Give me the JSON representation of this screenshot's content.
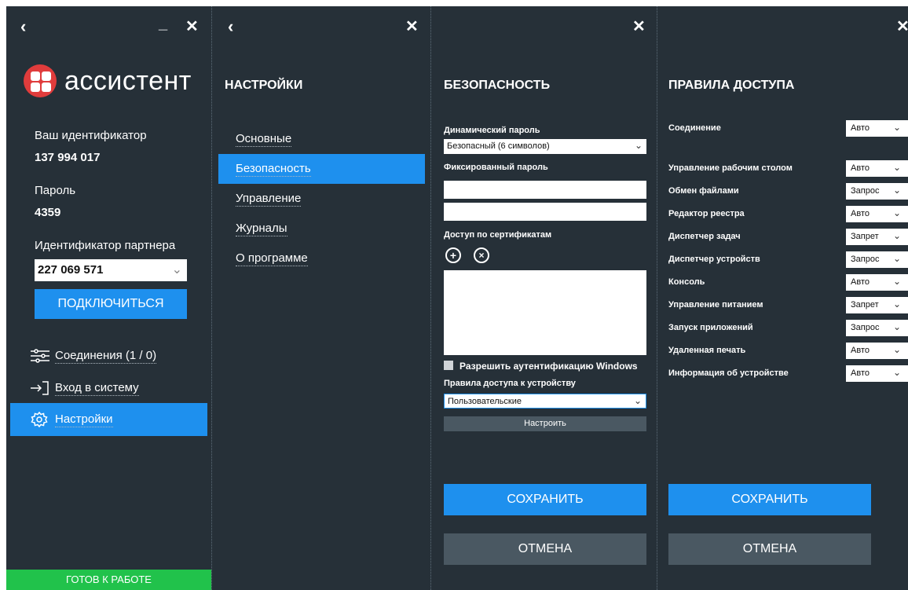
{
  "assistant": {
    "brand": "ассистент",
    "your_id_label": "Ваш идентификатор",
    "your_id_value": "137 994 017",
    "password_label": "Пароль",
    "password_value": "4359",
    "partner_label": "Идентификатор партнера",
    "partner_value": "227 069 571",
    "connect_label": "ПОДКЛЮЧИТЬСЯ",
    "menu": [
      {
        "label": "Соединения (1 / 0)",
        "icon": "sliders-icon"
      },
      {
        "label": "Вход в систему",
        "icon": "login-icon"
      },
      {
        "label": "Настройки",
        "icon": "gear-icon",
        "selected": true
      }
    ],
    "status": "ГОТОВ К РАБОТЕ",
    "status_color": "#21c24b"
  },
  "settings": {
    "title": "НАСТРОЙКИ",
    "items": [
      "Основные",
      "Безопасность",
      "Управление",
      "Журналы",
      "О программе"
    ],
    "selected": "Безопасность"
  },
  "security": {
    "title": "БЕЗОПАСНОСТЬ",
    "dynamic_password_label": "Динамический пароль",
    "dynamic_password_value": "Безопасный (6 символов)",
    "fixed_password_label": "Фиксированный пароль",
    "cert_access_label": "Доступ по сертификатам",
    "windows_auth_label": "Разрешить аутентификацию Windows",
    "device_rules_label": "Правила доступа к устройству",
    "device_rules_value": "Пользовательские",
    "configure_label": "Настроить",
    "save_label": "СОХРАНИТЬ",
    "cancel_label": "ОТМЕНА"
  },
  "rules": {
    "title": "ПРАВИЛА ДОСТУПА",
    "connection_label": "Соединение",
    "connection_value": "Авто",
    "items": [
      {
        "label": "Управление рабочим столом",
        "value": "Авто"
      },
      {
        "label": "Обмен файлами",
        "value": "Запрос"
      },
      {
        "label": "Редактор реестра",
        "value": "Авто"
      },
      {
        "label": "Диспетчер задач",
        "value": "Запрет"
      },
      {
        "label": "Диспетчер устройств",
        "value": "Запрос"
      },
      {
        "label": "Консоль",
        "value": "Авто"
      },
      {
        "label": "Управление питанием",
        "value": "Запрет"
      },
      {
        "label": "Запуск приложений",
        "value": "Запрос"
      },
      {
        "label": "Удаленная печать",
        "value": "Авто"
      },
      {
        "label": "Информация об устройстве",
        "value": "Авто"
      }
    ],
    "save_label": "СОХРАНИТЬ",
    "cancel_label": "ОТМЕНА"
  },
  "colors": {
    "panel_bg": "#263038",
    "accent": "#1e90ee",
    "secondary_button": "#4a5862",
    "logo": "#e03c3c"
  }
}
